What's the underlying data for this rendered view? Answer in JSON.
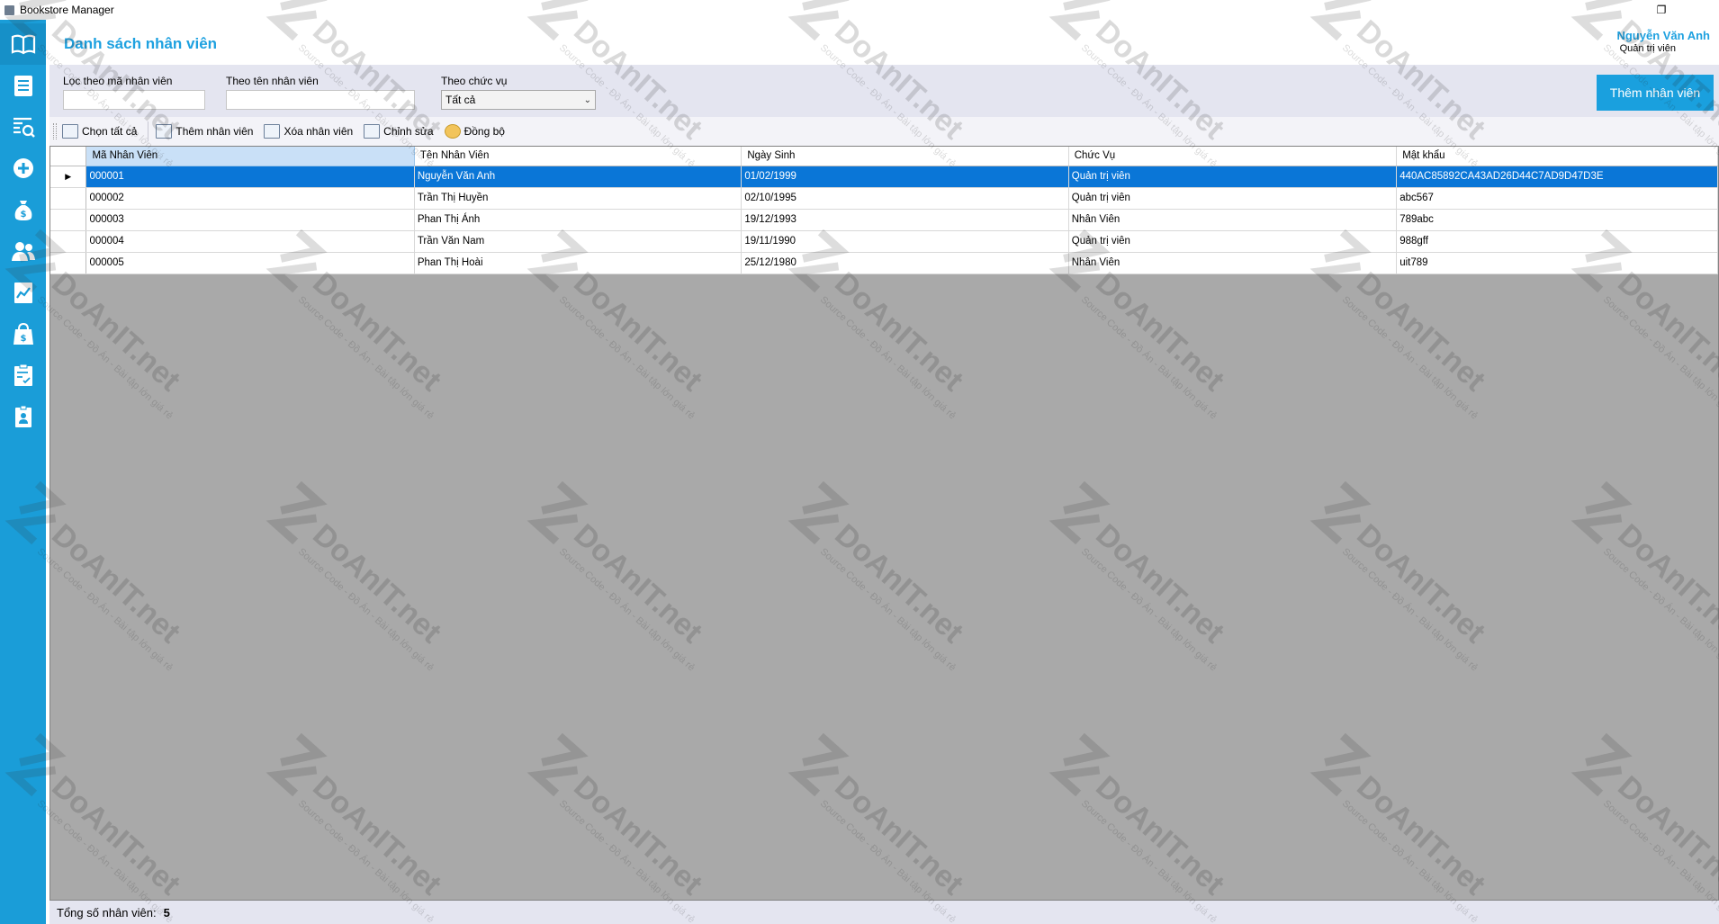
{
  "window": {
    "title": "Bookstore Manager"
  },
  "header": {
    "title": "Danh sách nhân viên",
    "user_name": "Nguyễn Văn Anh",
    "user_role": "Quản trị viên"
  },
  "filters": {
    "by_id_label": "Lọc theo mã nhân viên",
    "by_id_value": "",
    "by_name_label": "Theo tên nhân viên",
    "by_name_value": "",
    "by_role_label": "Theo chức vụ",
    "by_role_selected": "Tất cả",
    "add_button": "Thêm nhân viên"
  },
  "toolbar": {
    "select_all": "Chọn tất cả",
    "add": "Thêm nhân viên",
    "delete": "Xóa nhân viên",
    "edit": "Chỉnh sửa",
    "sync": "Đồng bộ"
  },
  "table": {
    "columns": [
      "Mã Nhân Viên",
      "Tên Nhân Viên",
      "Ngày Sinh",
      "Chức Vụ",
      "Mật khẩu"
    ],
    "rows": [
      [
        "000001",
        "Nguyễn Văn Anh",
        "01/02/1999",
        "Quản trị viên",
        "440AC85892CA43AD26D44C7AD9D47D3E"
      ],
      [
        "000002",
        "Trần Thị Huyền",
        "02/10/1995",
        "Quản trị viên",
        "abc567"
      ],
      [
        "000003",
        "Phan Thị Ánh",
        "19/12/1993",
        "Nhân Viên",
        "789abc"
      ],
      [
        "000004",
        "Trần Văn Nam",
        "19/11/1990",
        "Quản trị viên",
        "988gff"
      ],
      [
        "000005",
        "Phan Thị Hoài",
        "25/12/1980",
        "Nhân Viên",
        "uit789"
      ]
    ],
    "selected_row": 0
  },
  "footer": {
    "total_label": "Tổng số nhân viên:",
    "total_value": "5"
  },
  "watermark": {
    "brand": "DoAnIT.net",
    "tagline": "Source Code - Đồ Án - Bài tập lớn giá rẻ"
  },
  "sidebar_icons": [
    "book-icon",
    "list-icon",
    "search-report-icon",
    "add-circle-icon",
    "money-bag-icon",
    "users-icon",
    "chart-icon",
    "shopping-bag-icon",
    "clipboard-check-icon",
    "id-badge-icon"
  ],
  "colors": {
    "accent": "#1a9dd8",
    "selected_row": "#0a76d7",
    "grid_background": "#a9a9a9"
  }
}
